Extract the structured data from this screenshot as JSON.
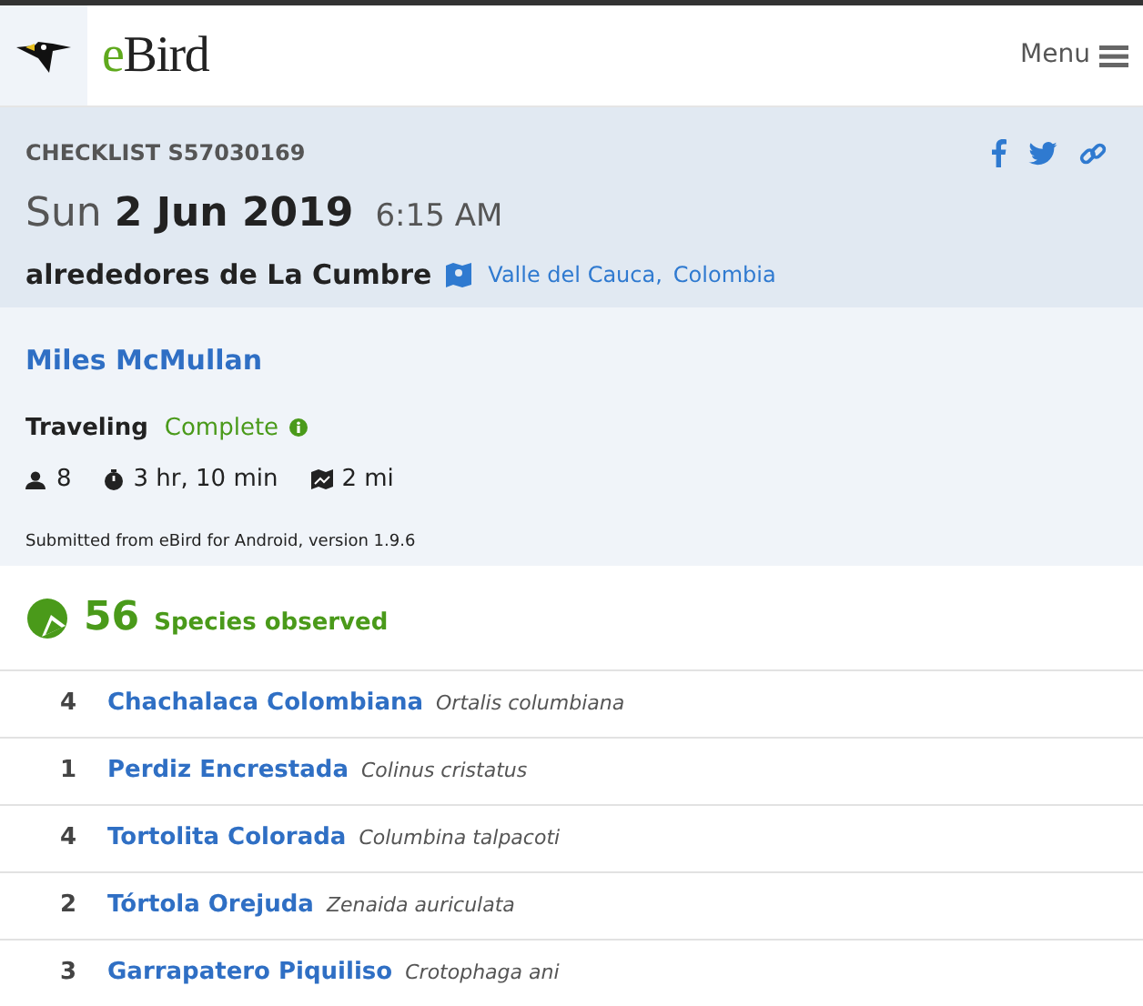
{
  "header": {
    "logo_text_first": "e",
    "logo_text_rest": "Bird",
    "menu_label": "Menu"
  },
  "checklist": {
    "id_label": "CHECKLIST S57030169",
    "weekday": "Sun",
    "date": "2 Jun 2019",
    "time": "6:15 AM",
    "location": "alrededores de La Cumbre",
    "region": "Valle del Cauca,",
    "country": "Colombia"
  },
  "observer": {
    "name": "Miles McMullan",
    "protocol": "Traveling",
    "status": "Complete",
    "observers": "8",
    "duration": "3 hr, 10 min",
    "distance": "2 mi",
    "submitted": "Submitted from eBird for Android, version 1.9.6"
  },
  "species_summary": {
    "count": "56",
    "label": "Species observed"
  },
  "species": [
    {
      "count": "4",
      "common": "Chachalaca Colombiana",
      "scientific": "Ortalis columbiana"
    },
    {
      "count": "1",
      "common": "Perdiz Encrestada",
      "scientific": "Colinus cristatus"
    },
    {
      "count": "4",
      "common": "Tortolita Colorada",
      "scientific": "Columbina talpacoti"
    },
    {
      "count": "2",
      "common": "Tórtola Orejuda",
      "scientific": "Zenaida auriculata"
    },
    {
      "count": "3",
      "common": "Garrapatero Piquiliso",
      "scientific": "Crotophaga ani"
    }
  ]
}
